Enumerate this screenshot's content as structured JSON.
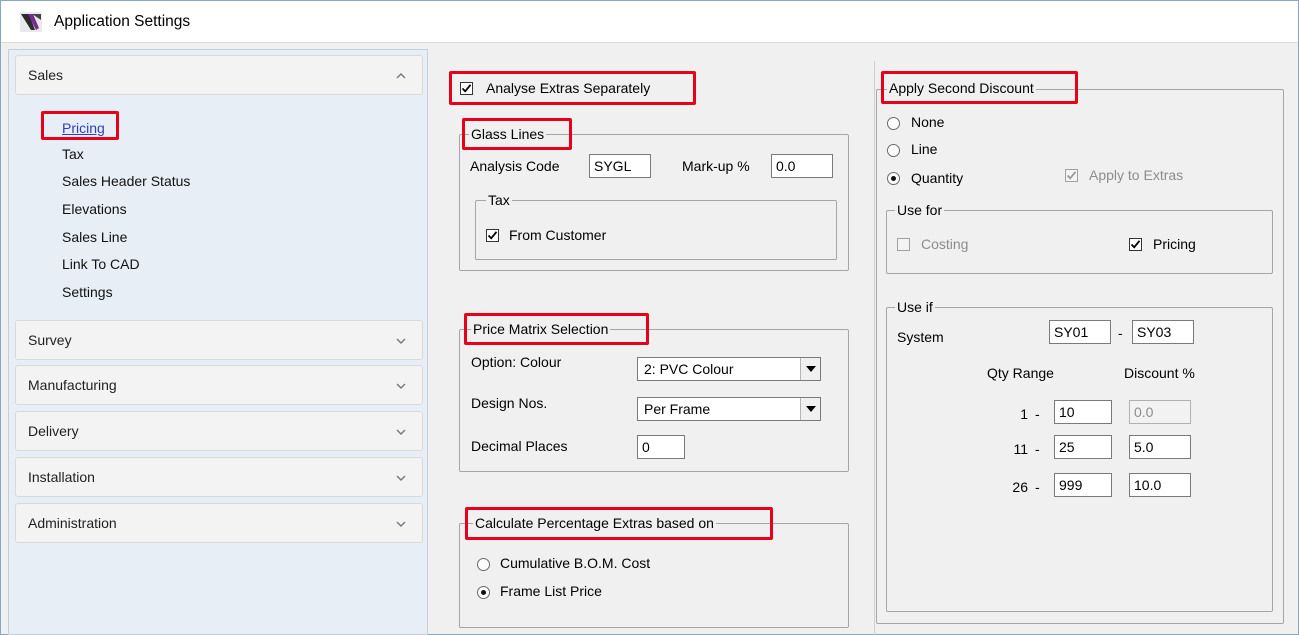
{
  "window": {
    "title": "Application Settings"
  },
  "sidebar": {
    "groups": [
      {
        "label": "Sales",
        "expanded": true
      },
      {
        "label": "Survey"
      },
      {
        "label": "Manufacturing"
      },
      {
        "label": "Delivery"
      },
      {
        "label": "Installation"
      },
      {
        "label": "Administration"
      }
    ],
    "sales_items": [
      "Pricing",
      "Tax",
      "Sales Header Status",
      "Elevations",
      "Sales Line",
      "Link To CAD",
      "Settings"
    ]
  },
  "pricing": {
    "analyse_extras": {
      "label": "Analyse Extras Separately",
      "checked": true
    },
    "glass_lines": {
      "legend": "Glass Lines",
      "analysis_code_label": "Analysis Code",
      "analysis_code_value": "SYGL",
      "markup_label": "Mark-up %",
      "markup_value": "0.0",
      "tax_legend": "Tax",
      "from_customer_label": "From Customer"
    },
    "price_matrix": {
      "legend": "Price Matrix Selection",
      "option_colour_label": "Option: Colour",
      "option_colour_value": "2: PVC Colour",
      "design_nos_label": "Design Nos.",
      "design_nos_value": "Per Frame",
      "decimal_places_label": "Decimal Places",
      "decimal_places_value": "0"
    },
    "calc_pct": {
      "legend": "Calculate Percentage Extras based on",
      "option1": "Cumulative B.O.M. Cost",
      "option2": "Frame List Price"
    },
    "second_discount": {
      "legend": "Apply Second Discount",
      "none_label": "None",
      "line_label": "Line",
      "quantity_label": "Quantity",
      "apply_extras_label": "Apply to Extras",
      "use_for_legend": "Use for",
      "costing_label": "Costing",
      "pricing_label": "Pricing",
      "use_if_legend": "Use if",
      "system_label": "System",
      "system_from": "SY01",
      "system_sep": "-",
      "system_to": "SY03",
      "qty_range_header": "Qty Range",
      "discount_header": "Discount %",
      "rows": [
        {
          "from": "1",
          "sep": "-",
          "to": "10",
          "discount": "0.0"
        },
        {
          "from": "11",
          "sep": "-",
          "to": "25",
          "discount": "5.0"
        },
        {
          "from": "26",
          "sep": "-",
          "to": "999",
          "discount": "10.0"
        }
      ]
    }
  },
  "colors": {
    "highlight": "#e6001a",
    "link": "#2a3ec8"
  }
}
